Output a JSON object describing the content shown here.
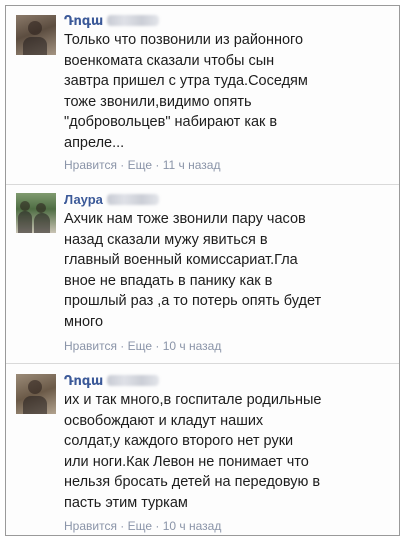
{
  "comments": [
    {
      "author": "Դոգա",
      "text_lines": [
        "Только что позвонили из районного",
        "военкомата сказали чтобы сын",
        "завтра пришел с утра туда.Соседям",
        "тоже звонили,видимо опять",
        "\"добровольцев\" набирают как в",
        "апреле..."
      ],
      "like_label": "Нравится",
      "more_label": "Еще",
      "time": "11 ч назад",
      "separator": " · "
    },
    {
      "author": "Лаура",
      "text_lines": [
        "Ахчик нам тоже звонили пару часов",
        "назад сказали мужу явиться в",
        "главный военный комиссариат.Гла",
        "вное не впадать в панику как в",
        "прошлый раз ,а то потерь опять будет",
        "много"
      ],
      "like_label": "Нравится",
      "more_label": "Еще",
      "time": "10 ч назад",
      "separator": " · "
    },
    {
      "author": "Դոգա",
      "text_lines": [
        "их и так много,в госпитале родильные",
        "освобождают и кладут наших",
        "солдат,у каждого второго нет руки",
        "или ноги.Как Левон не понимает что",
        "нельзя бросать детей на передовую в",
        "пасть этим туркам"
      ],
      "like_label": "Нравится",
      "more_label": "Еще",
      "time": "10 ч назад",
      "separator": " · "
    }
  ]
}
